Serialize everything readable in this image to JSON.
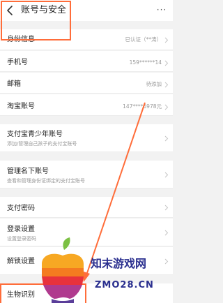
{
  "header": {
    "title": "账号与安全",
    "more": "···"
  },
  "rows": [
    {
      "label": "身份信息",
      "value": "已认证（**涛）"
    },
    {
      "label": "手机号",
      "value": "159******14"
    },
    {
      "label": "邮箱",
      "value": "待添加"
    },
    {
      "label": "淘宝账号",
      "value": "147****6978元"
    },
    {
      "label": "支付宝青少年账号",
      "sub": "添加/管理自己孩子的支付宝账号"
    },
    {
      "label": "管理名下账号",
      "sub": "查看和管理身份证绑定的支付宝账号"
    },
    {
      "label": "支付密码"
    },
    {
      "label": "登录设置",
      "sub": "设置登录密码"
    },
    {
      "label": "解锁设置"
    },
    {
      "label": "生物识别"
    }
  ],
  "watermark": {
    "cn": "知末游戏网",
    "en": "ZMO28.CN"
  },
  "colors": {
    "accent": "#ff6d3a",
    "watermark_text": "#2a2f8f"
  }
}
